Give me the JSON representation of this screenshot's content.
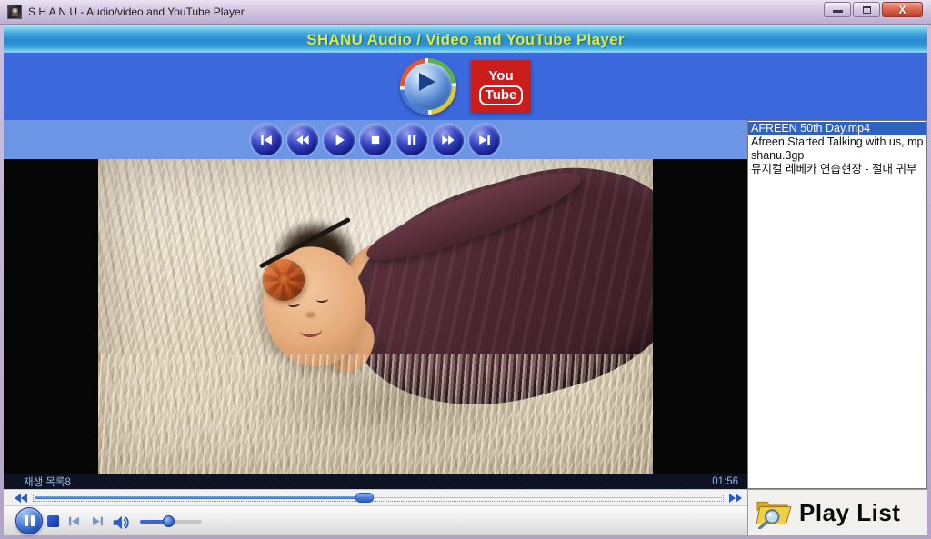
{
  "window": {
    "title": "S H A N U - Audio/video and YouTube Player",
    "close_glyph": "X"
  },
  "banner": {
    "title": "SHANU Audio / Video and YouTube Player"
  },
  "hero": {
    "youtube_logo": {
      "top": "You",
      "bottom": "Tube"
    },
    "icons": [
      "media-player-icon",
      "youtube-logo"
    ]
  },
  "transport": {
    "buttons": [
      "previous",
      "rewind",
      "play",
      "stop",
      "pause",
      "fast-forward",
      "next"
    ]
  },
  "playlist": {
    "items": [
      {
        "label": "AFREEN 50th Day.mp4",
        "selected": true
      },
      {
        "label": "Afreen Started Talking with us,.mp",
        "selected": false
      },
      {
        "label": "shanu.3gp",
        "selected": false
      },
      {
        "label": "뮤지컬 레베카 연습현장 - 절대 귀부",
        "selected": false
      }
    ],
    "footer_label": "Play List"
  },
  "video_overlay": {
    "status_left": "재생 목록8",
    "time_right": "01:56"
  },
  "seek": {
    "position_pct": 48
  },
  "volume": {
    "level_pct": 47
  },
  "colors": {
    "hero_blue": "#3b68dd",
    "band_blue": "#6d95e6",
    "banner_text": "#dcec3e",
    "selection_blue": "#2e62c4",
    "youtube_red": "#cc1d1d"
  }
}
